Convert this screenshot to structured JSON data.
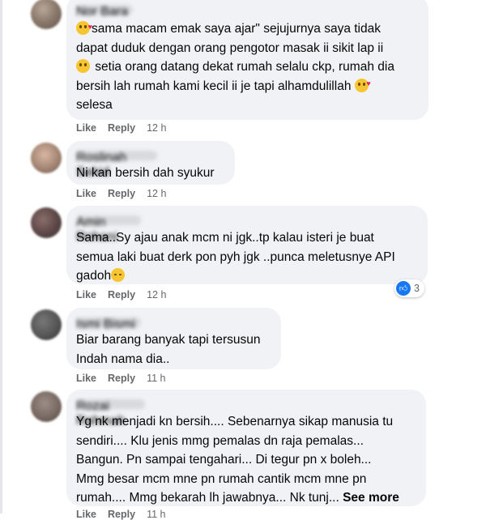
{
  "comments": [
    {
      "author": "Nor Bara",
      "segments": [
        {
          "emoji": "smiling-face-with-hearts"
        },
        {
          "text": "sama macam emak saya ajar\" sejujurnya saya tidak\ndapat duduk dengan orang pengotor masak ii sikit lap ii\n"
        },
        {
          "emoji": "grimacing-face"
        },
        {
          "text": " setia orang datang dekat rumah selalu ckp, rumah dia\nbersih lah rumah kami kecil ii je tapi alhamdulillah "
        },
        {
          "emoji": "smiling-face-with-hearts"
        },
        {
          "text": "\nselesa"
        }
      ],
      "like_label": "Like",
      "reply_label": "Reply",
      "time": "12 h"
    },
    {
      "author": "Roslinah Sahid",
      "text": "Ni kan bersih dah syukur",
      "like_label": "Like",
      "reply_label": "Reply",
      "time": "12 h"
    },
    {
      "author": "Amin Rohani",
      "text_before": "Sama..Sy ajau anak mcm ni jgk..tp kalau isteri je buat\nsemua laki buat derk pon pyh jgk ..punca meletusnye API\ngadoh",
      "emoji": "pensive-face",
      "like_label": "Like",
      "reply_label": "Reply",
      "time": "12 h",
      "reaction_icon": "like-reaction-icon",
      "reaction_count": "3"
    },
    {
      "author": "Ismi Bismi",
      "text": "Biar barang banyak tapi tersusun\nIndah nama dia..",
      "like_label": "Like",
      "reply_label": "Reply",
      "time": "11 h"
    },
    {
      "author": "Rozai Rahmah",
      "text": "Yg nk menjadi kn bersih.... Sebenarnya sikap manusia tu\nsendiri.... Klu jenis mmg pemalas dn raja pemalas...\nBangun. Pn sampai tengahari... Di tegur pn x boleh...\nMmg besar mcm mne pn rumah cantik mcm mne pn\nrumah.... Mmg bekarah lh jawabnya... Nk tunj... ",
      "see_more": "See more",
      "like_label": "Like",
      "reply_label": "Reply",
      "time": "11 h"
    }
  ]
}
